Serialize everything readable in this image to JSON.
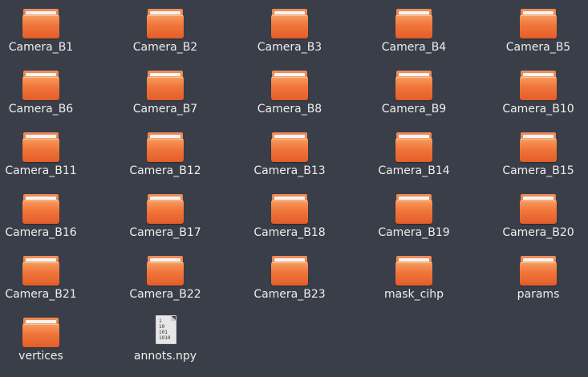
{
  "window": {
    "background": "#3a3e48",
    "text_color": "#eeeeec"
  },
  "items": [
    {
      "label": "Camera_B1",
      "icon": "folder-icon"
    },
    {
      "label": "Camera_B2",
      "icon": "folder-icon"
    },
    {
      "label": "Camera_B3",
      "icon": "folder-icon"
    },
    {
      "label": "Camera_B4",
      "icon": "folder-icon"
    },
    {
      "label": "Camera_B5",
      "icon": "folder-icon"
    },
    {
      "label": "Camera_B6",
      "icon": "folder-icon"
    },
    {
      "label": "Camera_B7",
      "icon": "folder-icon"
    },
    {
      "label": "Camera_B8",
      "icon": "folder-icon"
    },
    {
      "label": "Camera_B9",
      "icon": "folder-icon"
    },
    {
      "label": "Camera_B10",
      "icon": "folder-icon"
    },
    {
      "label": "Camera_B11",
      "icon": "folder-icon"
    },
    {
      "label": "Camera_B12",
      "icon": "folder-icon"
    },
    {
      "label": "Camera_B13",
      "icon": "folder-icon"
    },
    {
      "label": "Camera_B14",
      "icon": "folder-icon"
    },
    {
      "label": "Camera_B15",
      "icon": "folder-icon"
    },
    {
      "label": "Camera_B16",
      "icon": "folder-icon"
    },
    {
      "label": "Camera_B17",
      "icon": "folder-icon"
    },
    {
      "label": "Camera_B18",
      "icon": "folder-icon"
    },
    {
      "label": "Camera_B19",
      "icon": "folder-icon"
    },
    {
      "label": "Camera_B20",
      "icon": "folder-icon"
    },
    {
      "label": "Camera_B21",
      "icon": "folder-icon"
    },
    {
      "label": "Camera_B22",
      "icon": "folder-icon"
    },
    {
      "label": "Camera_B23",
      "icon": "folder-icon"
    },
    {
      "label": "mask_cihp",
      "icon": "folder-icon"
    },
    {
      "label": "params",
      "icon": "folder-icon"
    },
    {
      "label": "vertices",
      "icon": "folder-icon"
    },
    {
      "label": "annots.npy",
      "icon": "binary-file-icon",
      "icon_text": "1\n10\n101\n1010"
    }
  ]
}
